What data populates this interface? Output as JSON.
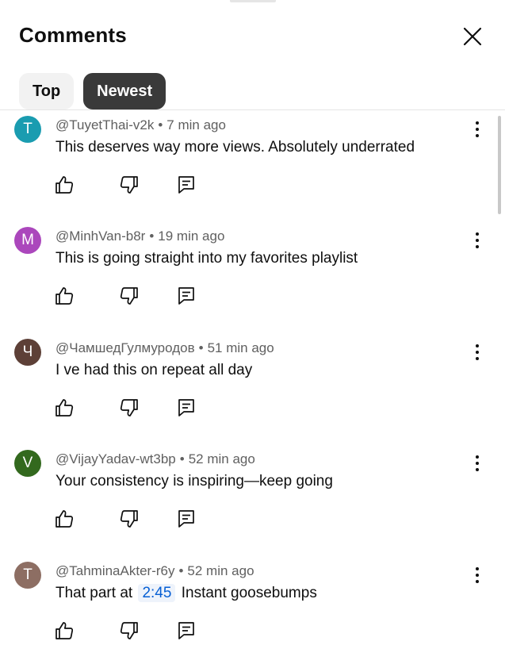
{
  "header": {
    "title": "Comments"
  },
  "tabs": [
    {
      "label": "Top",
      "active": false
    },
    {
      "label": "Newest",
      "active": true
    }
  ],
  "comments": [
    {
      "initial": "T",
      "avatar_color": "#1a9cb0",
      "author": "@TuyetThai-v2k",
      "time": "7 min ago",
      "text_before": "This deserves way more views. Absolutely underrated",
      "timestamp": "",
      "text_after": ""
    },
    {
      "initial": "M",
      "avatar_color": "#ab47bc",
      "author": "@MinhVan-b8r",
      "time": "19 min ago",
      "text_before": "This is going straight into my favorites playlist",
      "timestamp": "",
      "text_after": ""
    },
    {
      "initial": "Ч",
      "avatar_color": "#5d4037",
      "author": "@ЧамшедГулмуродов",
      "time": "51 min ago",
      "text_before": "I ve had this on repeat all day",
      "timestamp": "",
      "text_after": ""
    },
    {
      "initial": "V",
      "avatar_color": "#33691e",
      "author": "@VijayYadav-wt3bp",
      "time": "52 min ago",
      "text_before": "Your consistency is inspiring—keep going",
      "timestamp": "",
      "text_after": ""
    },
    {
      "initial": "T",
      "avatar_color": "#8d6e63",
      "author": "@TahminaAkter-r6y",
      "time": "52 min ago",
      "text_before": "That part at",
      "timestamp": "2:45",
      "text_after": "Instant goosebumps"
    }
  ]
}
